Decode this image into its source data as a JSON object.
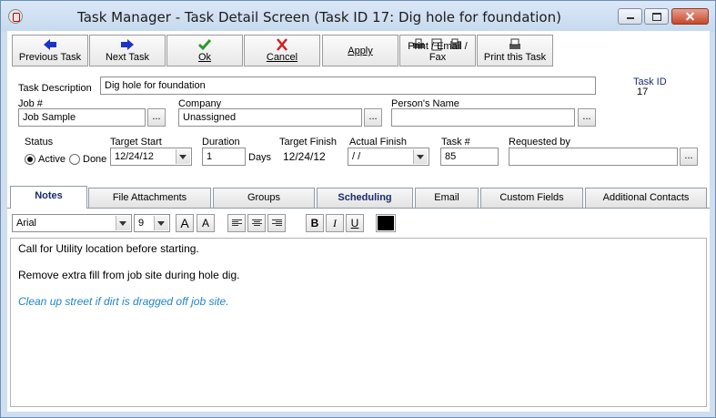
{
  "window": {
    "title": "Task Manager - Task Detail Screen (Task ID 17: Dig hole for foundation)"
  },
  "toolbar": {
    "previous_label": "Previous Task",
    "next_label": "Next Task",
    "ok_label": "Ok",
    "cancel_label": "Cancel",
    "apply_label": "Apply",
    "print_email_fax_label": "Print / Email / Fax",
    "print_task_label": "Print this Task"
  },
  "task_id": {
    "label": "Task ID",
    "value": "17"
  },
  "form": {
    "task_description": {
      "label": "Task Description",
      "value": "Dig hole for foundation"
    },
    "job": {
      "label": "Job #",
      "value": "Job Sample"
    },
    "company": {
      "label": "Company",
      "value": "Unassigned"
    },
    "persons_name": {
      "label": "Person's Name",
      "value": ""
    },
    "status": {
      "label": "Status",
      "active_label": "Active",
      "done_label": "Done",
      "selected": "Active"
    },
    "target_start": {
      "label": "Target Start",
      "value": "12/24/12"
    },
    "duration": {
      "label": "Duration",
      "value": "1",
      "unit": "Days"
    },
    "target_finish": {
      "label": "Target Finish",
      "value": "12/24/12"
    },
    "actual_finish": {
      "label": "Actual Finish",
      "value": " / /"
    },
    "task_number": {
      "label": "Task #",
      "value": "85"
    },
    "requested_by": {
      "label": "Requested by",
      "value": ""
    },
    "ellipsis": "..."
  },
  "tabs": [
    {
      "label": "Notes"
    },
    {
      "label": "File Attachments"
    },
    {
      "label": "Groups"
    },
    {
      "label": "Scheduling"
    },
    {
      "label": "Email"
    },
    {
      "label": "Custom Fields"
    },
    {
      "label": "Additional Contacts"
    }
  ],
  "format_bar": {
    "font": "Arial",
    "size": "9",
    "bold": "B",
    "italic": "I",
    "underline": "U",
    "grow": "A",
    "shrink": "A",
    "text_color": "#000000"
  },
  "notes": {
    "line1": "Call for Utility location before starting.",
    "line2": "Remove extra fill from job site during hole dig.",
    "line3": "Clean up street if dirt is dragged off job site.",
    "line3_color": "#1e86c8"
  },
  "colors": {
    "accent": "#1a2b6a",
    "arrow_blue": "#1c33c8",
    "ok_green": "#2a9a2a",
    "cancel_red": "#d42020"
  }
}
